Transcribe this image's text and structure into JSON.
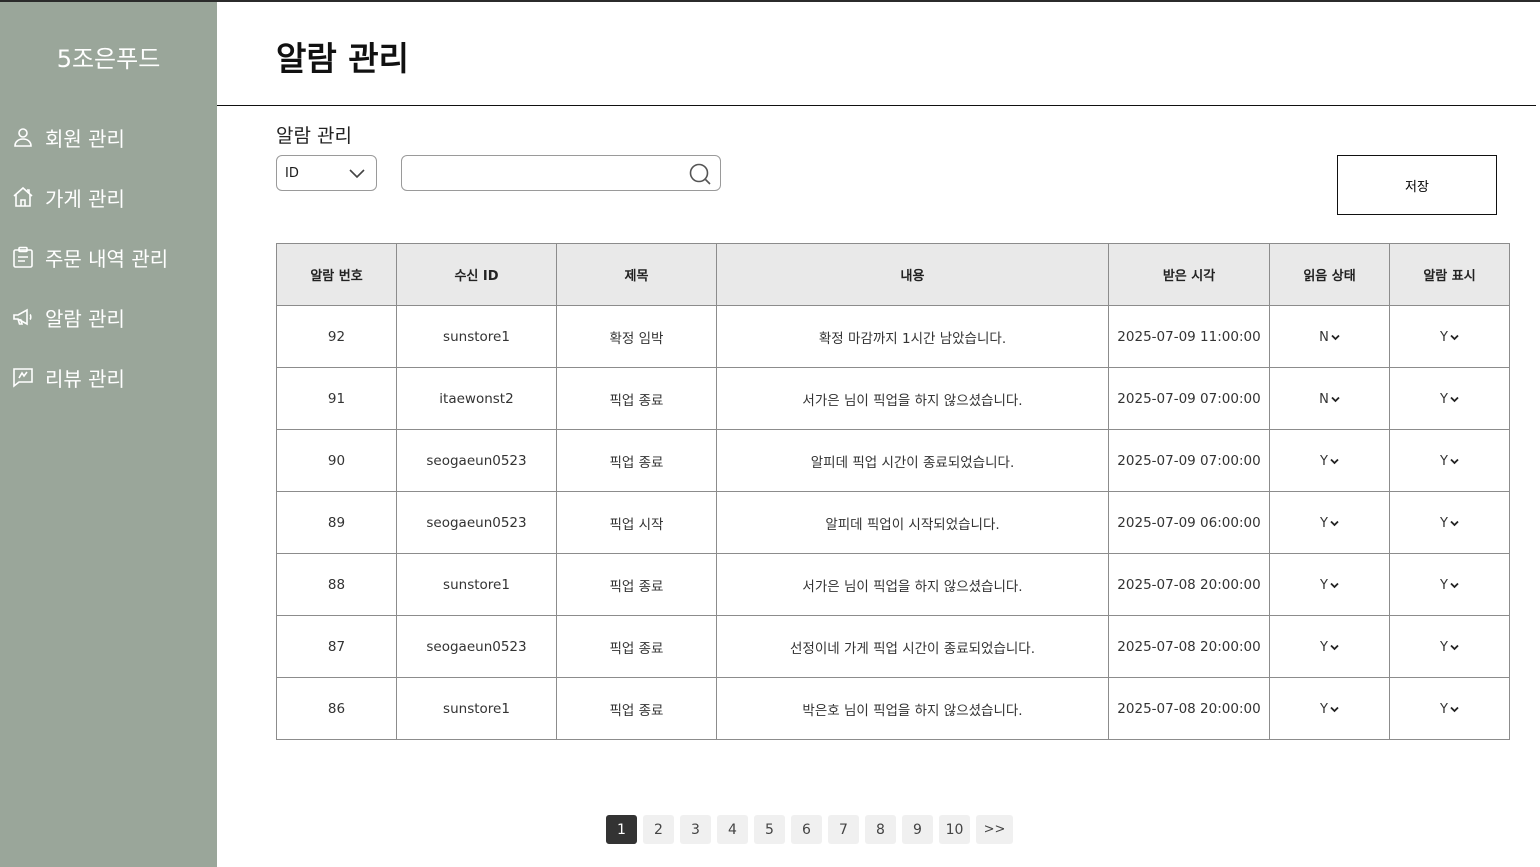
{
  "brand": "5조은푸드",
  "sidebar": {
    "items": [
      {
        "label": "회원 관리",
        "icon": "user-icon"
      },
      {
        "label": "가게 관리",
        "icon": "home-icon"
      },
      {
        "label": "주문 내역 관리",
        "icon": "clipboard-icon"
      },
      {
        "label": "알람 관리",
        "icon": "megaphone-icon"
      },
      {
        "label": "리뷰 관리",
        "icon": "review-icon"
      }
    ]
  },
  "header": {
    "title": "알람 관리"
  },
  "filter": {
    "section_label": "알람 관리",
    "select_value": "ID",
    "search_value": "",
    "save_label": "저장"
  },
  "table": {
    "headers": [
      "알람 번호",
      "수신 ID",
      "제목",
      "내용",
      "받은 시각",
      "읽음 상태",
      "알람 표시"
    ],
    "rows": [
      {
        "no": "92",
        "rid": "sunstore1",
        "title": "확정 임박",
        "content": "확정 마감까지 1시간 남았습니다.",
        "time": "2025-07-09 11:00:00",
        "read": "N",
        "show": "Y"
      },
      {
        "no": "91",
        "rid": "itaewonst2",
        "title": "픽업 종료",
        "content": "서가은 님이 픽업을 하지 않으셨습니다.",
        "time": "2025-07-09 07:00:00",
        "read": "N",
        "show": "Y"
      },
      {
        "no": "90",
        "rid": "seogaeun0523",
        "title": "픽업 종료",
        "content": "알피데 픽업 시간이 종료되었습니다.",
        "time": "2025-07-09 07:00:00",
        "read": "Y",
        "show": "Y"
      },
      {
        "no": "89",
        "rid": "seogaeun0523",
        "title": "픽업 시작",
        "content": "알피데 픽업이 시작되었습니다.",
        "time": "2025-07-09 06:00:00",
        "read": "Y",
        "show": "Y"
      },
      {
        "no": "88",
        "rid": "sunstore1",
        "title": "픽업 종료",
        "content": "서가은 님이 픽업을 하지 않으셨습니다.",
        "time": "2025-07-08 20:00:00",
        "read": "Y",
        "show": "Y"
      },
      {
        "no": "87",
        "rid": "seogaeun0523",
        "title": "픽업 종료",
        "content": "선정이네 가게 픽업 시간이 종료되었습니다.",
        "time": "2025-07-08 20:00:00",
        "read": "Y",
        "show": "Y"
      },
      {
        "no": "86",
        "rid": "sunstore1",
        "title": "픽업 종료",
        "content": "박은호 님이 픽업을 하지 않으셨습니다.",
        "time": "2025-07-08 20:00:00",
        "read": "Y",
        "show": "Y"
      }
    ]
  },
  "pagination": {
    "pages": [
      "1",
      "2",
      "3",
      "4",
      "5",
      "6",
      "7",
      "8",
      "9",
      "10"
    ],
    "current": "1",
    "next_label": ">>"
  }
}
